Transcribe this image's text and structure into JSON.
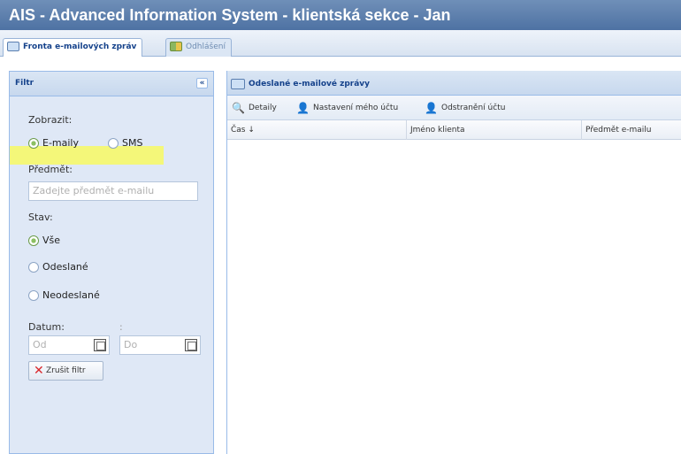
{
  "window": {
    "title": "AIS - Advanced Information System - klientská sekce - Jan"
  },
  "tabs": [
    {
      "label": "Fronta e-mailových zpráv",
      "icon": "mail-queue-icon",
      "active": true
    },
    {
      "label": "Odhlášení",
      "icon": "logout-grid-icon",
      "active": false
    }
  ],
  "filter": {
    "title": "Filtr",
    "collapse_glyph": "«",
    "show_label": "Zobrazit:",
    "show_options": [
      {
        "label": "E-maily",
        "selected": true
      },
      {
        "label": "SMS",
        "selected": false
      }
    ],
    "subject_label": "Předmět:",
    "subject_placeholder": "Zadejte předmět e-mailu",
    "state_label": "Stav:",
    "state_options": [
      {
        "label": "Vše",
        "selected": true
      },
      {
        "label": "Odeslané",
        "selected": false
      },
      {
        "label": "Neodeslané",
        "selected": false
      }
    ],
    "date_label": "Datum:",
    "date_separator": ":",
    "date_from_placeholder": "Od",
    "date_to_placeholder": "Do",
    "clear_button": "Zrušit filtr"
  },
  "messages_panel": {
    "title": "Odeslané e-mailové zprávy",
    "toolbar": [
      {
        "label": "Detaily",
        "icon": "magnifier-icon"
      },
      {
        "label": "Nastavení mého účtu",
        "icon": "user-settings-icon"
      },
      {
        "label": "Odstranění účtu",
        "icon": "delete-account-icon"
      }
    ],
    "columns": [
      "Čas ↓",
      "Jméno klienta",
      "Předmět e-mailu"
    ],
    "rows": []
  },
  "colors": {
    "titlebar": "#5577a8",
    "panel_bg": "#dfe8f6",
    "highlight": "#f4f779",
    "clear_icon": "#d9262a"
  }
}
